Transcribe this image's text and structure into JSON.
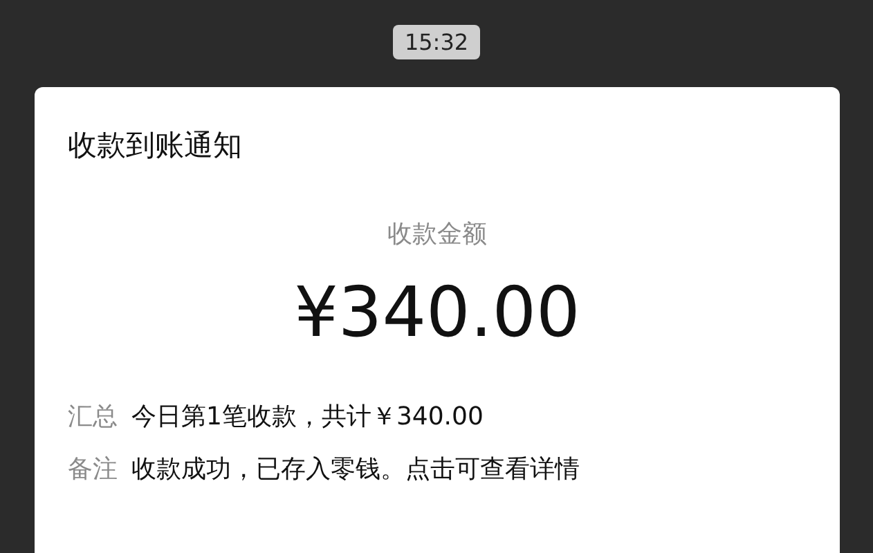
{
  "time": "15:32",
  "card": {
    "title": "收款到账通知",
    "amount_label": "收款金额",
    "amount": "¥340.00",
    "details": [
      {
        "label": "汇总",
        "value": "今日第1笔收款，共计￥340.00"
      },
      {
        "label": "备注",
        "value": "收款成功，已存入零钱。点击可查看详情"
      }
    ]
  }
}
